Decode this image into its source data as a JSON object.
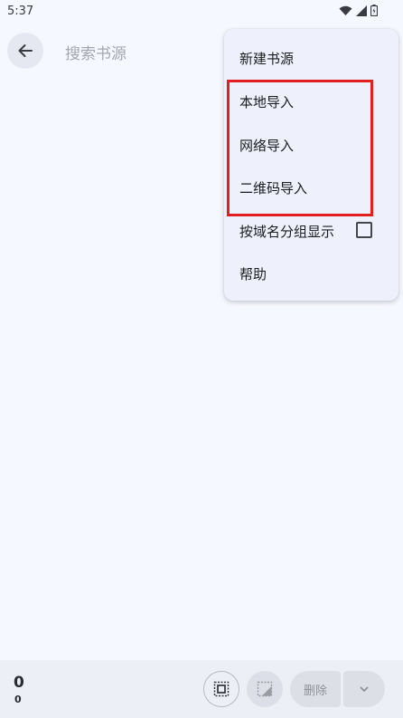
{
  "status": {
    "time": "5:37"
  },
  "search": {
    "placeholder": "搜索书源"
  },
  "menu": {
    "items": [
      {
        "label": "新建书源"
      },
      {
        "label": "本地导入"
      },
      {
        "label": "网络导入"
      },
      {
        "label": "二维码导入"
      },
      {
        "label": "按域名分组显示",
        "checked": false
      },
      {
        "label": "帮助"
      }
    ]
  },
  "bottom": {
    "count": "0",
    "sub_count": "0",
    "delete_label": "删除"
  },
  "icons": {
    "back": "arrow-left-icon",
    "select_all": "select-all-icon",
    "invert": "invert-selection-icon",
    "more": "chevron-down-icon",
    "wifi": "wifi-icon",
    "signal": "signal-icon",
    "battery": "battery-icon"
  },
  "colors": {
    "highlight": "#e02020",
    "background": "#f6f8ff",
    "menu": "#eef1fb"
  }
}
